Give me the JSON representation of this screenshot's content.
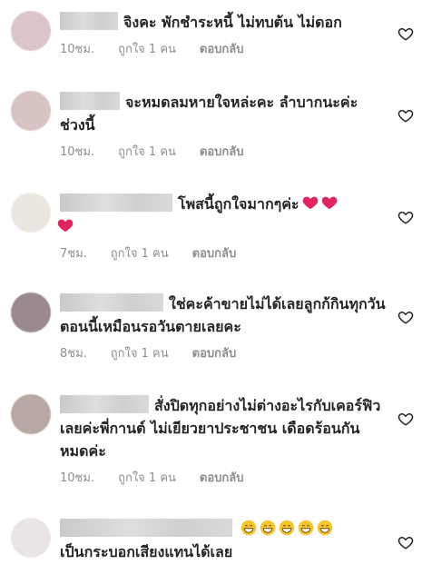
{
  "comments": [
    {
      "avatar_color": "#dcc5c8",
      "text": "จิงคะ พักชำระหนี้ ไม่ทบต้น ไม่ดอก",
      "time": "10ชม.",
      "likes": "ถูกใจ 1 คน",
      "reply": "ตอบกลับ"
    },
    {
      "avatar_color": "#d7c3c2",
      "text": "จะหมดลมหายใจหล่ะคะ ลำบากนะค่ะ ช่วงนี้",
      "time": "10ชม.",
      "likes": "ถูกใจ 1 คน",
      "reply": "ตอบกลับ"
    },
    {
      "avatar_color": "#ece6e1",
      "text": "โพสนี้ถูกใจมากๆค่ะ",
      "emoji": "red-heart-emoji",
      "time": "7ชม.",
      "likes": "ถูกใจ 1 คน",
      "reply": "ตอบกลับ"
    },
    {
      "avatar_color": "#9b8a8d",
      "text": "ใช่คะค้าขายไม่ได้เลยลูกก้กินทุกวันตอนนี้เหมือนรอวันตายเลยคะ",
      "time": "8ชม.",
      "likes": "ถูกใจ 1 คน",
      "reply": "ตอบกลับ"
    },
    {
      "avatar_color": "#b8a8a3",
      "text": "สั่งปิดทุกอย่างไม่ต่างอะไรกับเคอร์ฟิวเลยค่ะพี่กานต์ ไม่เยียวยาประชาชน เดือดร้อนกันหมดค่ะ",
      "time": "10ชม.",
      "likes": "ถูกใจ 1 คน",
      "reply": "ตอบกลับ"
    },
    {
      "avatar_color": "#ebe5e6",
      "text": "เป็นกระบอกเสียงแทนได้เลย",
      "emoji": "grinning-face-emoji",
      "time": "",
      "likes": "",
      "reply": ""
    }
  ],
  "icons": {
    "like": "heart-outline-icon"
  },
  "colors": {
    "text": "#262626",
    "meta": "#8e8e8e",
    "heart_emoji": "#e0245e",
    "grin_emoji": "#f7c52a"
  }
}
